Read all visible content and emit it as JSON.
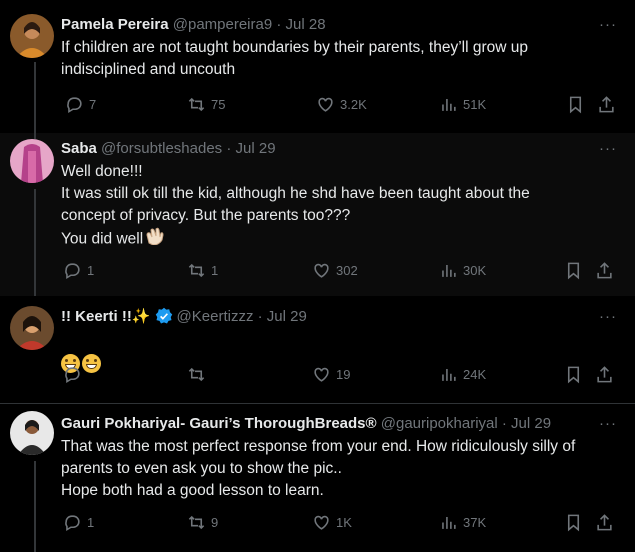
{
  "tweets": [
    {
      "name": "Pamela Pereira",
      "handle": "@pampereira9",
      "date": "Jul 28",
      "text": "If children are not taught boundaries by their parents, they’ll grow up\nindisciplined and uncouth",
      "replies": "7",
      "retweets": "75",
      "likes": "3.2K",
      "views": "51K"
    },
    {
      "name": "Saba",
      "handle": "@forsubtleshades",
      "date": "Jul 29",
      "text": "Well done!!!\nIt was still ok till the kid, although he shd have been taught about the\nconcept of privacy. But the parents too???\nYou did well",
      "emoji": "clapping-hands",
      "replies": "1",
      "retweets": "1",
      "likes": "302",
      "views": "30K"
    },
    {
      "name": "!! Keerti !!",
      "name_emoji": "✨",
      "verified": true,
      "handle": "@Keertizzz",
      "date": "Jul 29",
      "emojis": [
        "grinning-face",
        "grinning-face"
      ],
      "replies": "",
      "retweets": "",
      "likes": "19",
      "views": "24K"
    },
    {
      "name": "Gauri Pokhariyal- Gauri’s ThoroughBreads®",
      "handle": "@gauripokhariyal",
      "date": "Jul 29",
      "text": "That was the most perfect response from your end. How ridiculously silly of\nparents to even ask you to show the pic..\nHope both had a good lesson to learn.",
      "replies": "1",
      "retweets": "9",
      "likes": "1K",
      "views": "37K"
    }
  ],
  "separator": "·",
  "more_label": "···",
  "colors": {
    "background": "#000000",
    "text": "#e7e9ea",
    "muted": "#71767b",
    "verified": "#1d9bf0",
    "line": "#333639"
  }
}
